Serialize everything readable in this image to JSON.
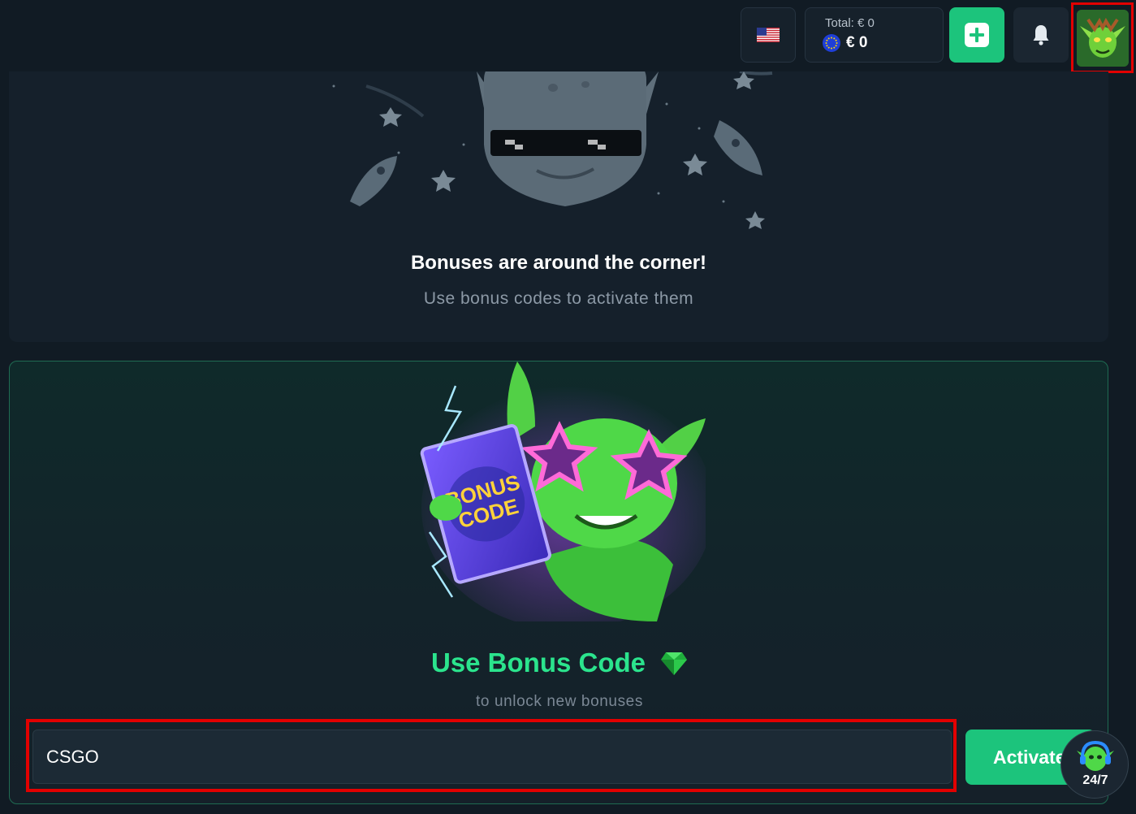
{
  "header": {
    "language_flag": "us-flag-icon",
    "balance": {
      "total_label": "Total: € 0",
      "currency_icon": "euro-coin-icon",
      "amount": "€ 0"
    },
    "deposit_icon": "plus-icon",
    "notifications_icon": "bell-icon",
    "avatar": "goblin-avatar"
  },
  "empty_state": {
    "illustration": "goblin-sunglasses-rockets-illustration",
    "title": "Bonuses are around the corner!",
    "subtitle": "Use bonus codes to activate them"
  },
  "bonus_code": {
    "illustration": "goblin-bonus-code-pack-illustration",
    "pack_text_1": "BONUS",
    "pack_text_2": "CODE",
    "title": "Use Bonus Code",
    "title_icon": "green-gem-icon",
    "subtitle": "to unlock new bonuses",
    "input_value": "CSGO",
    "activate_label": "Activate"
  },
  "support": {
    "label": "24/7",
    "icon": "support-goblin-headset-icon"
  },
  "colors": {
    "background": "#111b24",
    "panel": "#15202b",
    "accent_green": "#1cc47c",
    "title_green": "#2be48d",
    "highlight_red": "#e20000"
  }
}
